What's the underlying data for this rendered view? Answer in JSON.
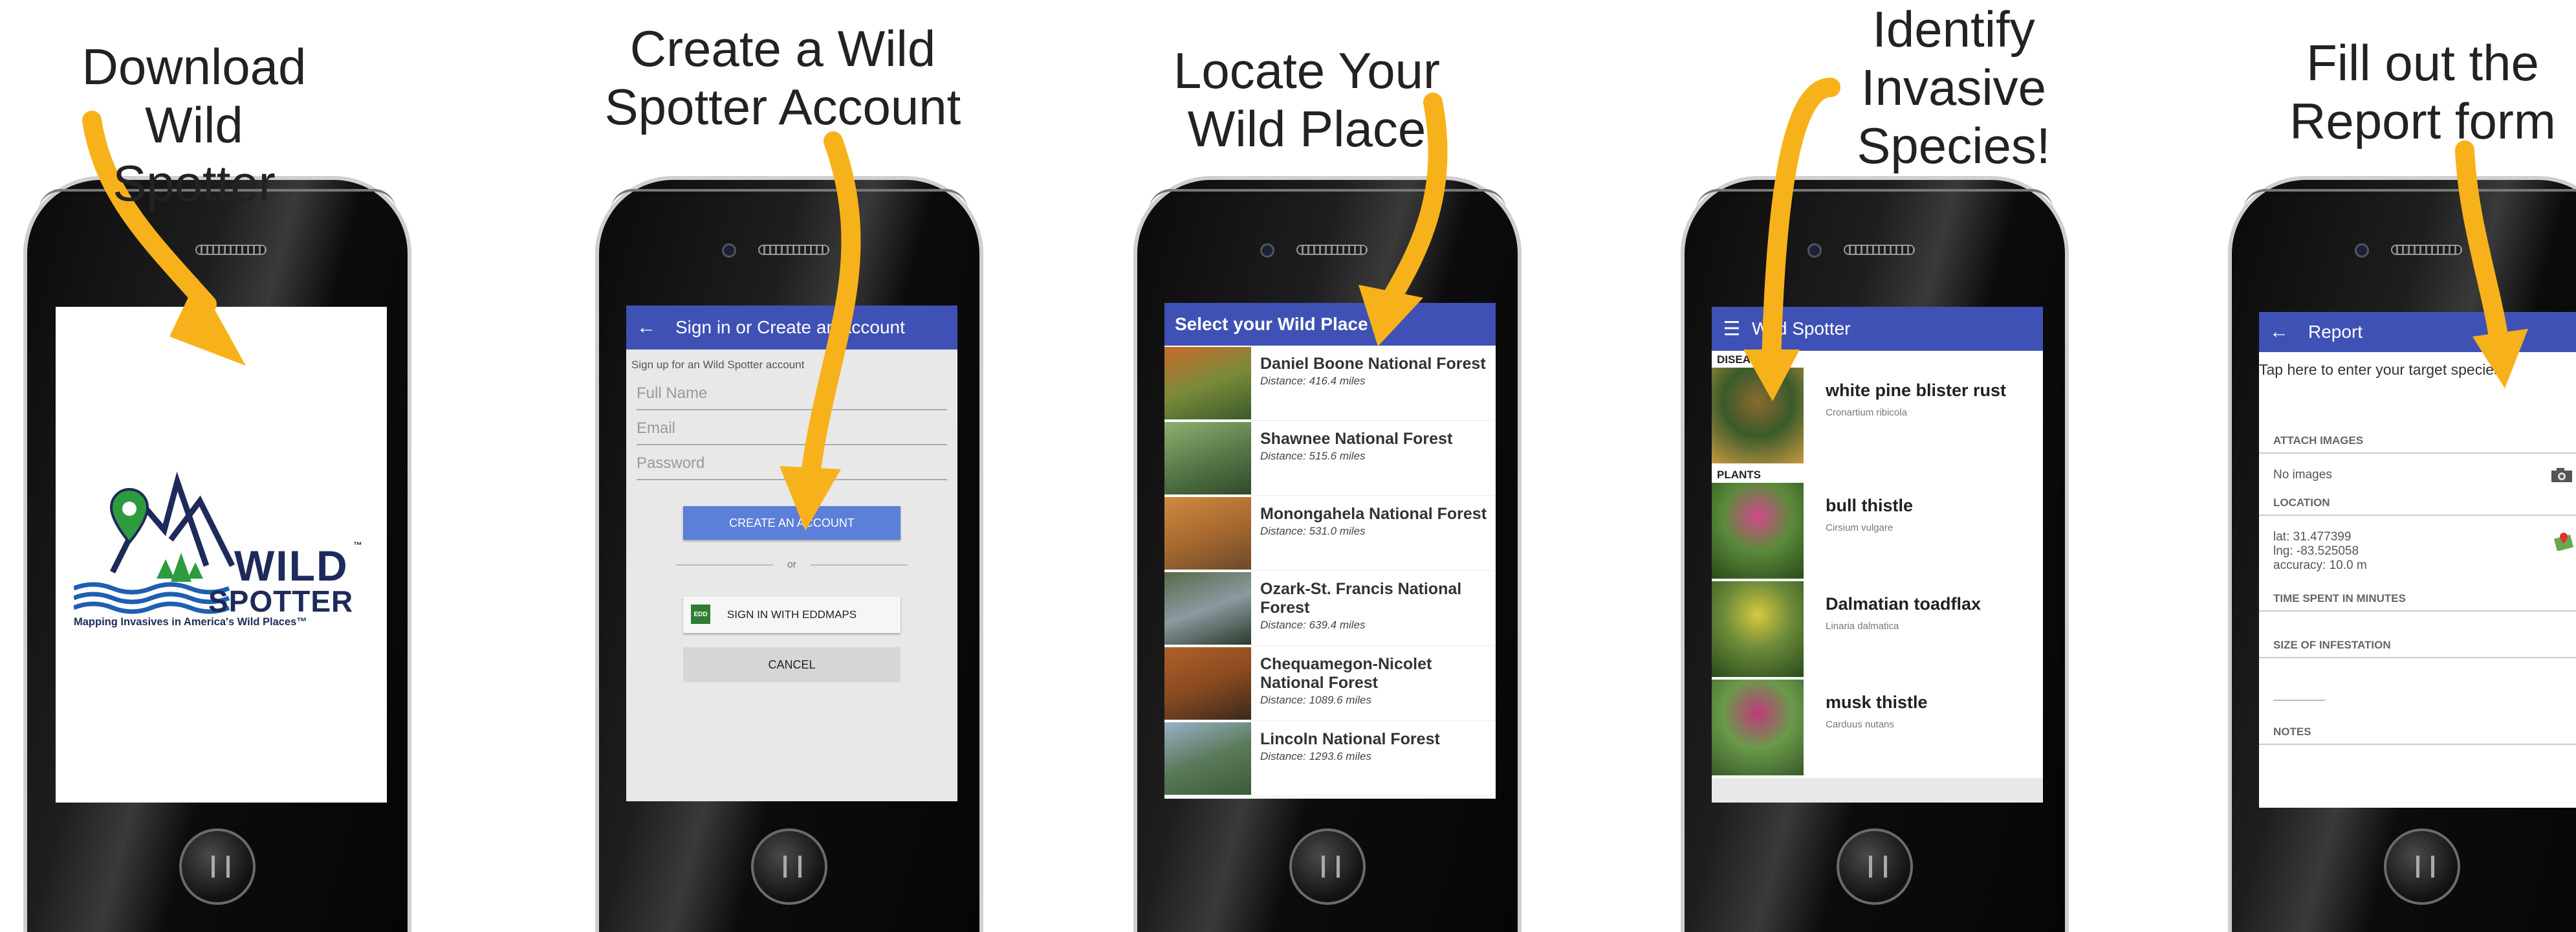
{
  "steps": [
    {
      "caption": "Download Wild\nSpotter"
    },
    {
      "caption": "Create a Wild\nSpotter Account"
    },
    {
      "caption": "Locate Your\nWild Place"
    },
    {
      "caption": "Identify\nInvasive\nSpecies!"
    },
    {
      "caption": "Fill out the\nReport form"
    }
  ],
  "logo": {
    "wild": "WILD",
    "spotter": "SPOTTER",
    "tm": "™",
    "tagline": "Mapping Invasives in America's Wild Places™"
  },
  "signin": {
    "title": "Sign in or Create an account",
    "signup_text": "Sign up for an Wild Spotter account",
    "full_name_placeholder": "Full Name",
    "email_placeholder": "Email",
    "password_placeholder": "Password",
    "create_button": "CREATE AN ACCOUNT",
    "or_text": "or",
    "eddmaps_button": "SIGN IN WITH EDDMAPS",
    "eddmaps_mark": "EDD",
    "cancel_button": "CANCEL"
  },
  "places": {
    "title": "Select your Wild Place",
    "items": [
      {
        "name": "Daniel Boone National Forest",
        "distance": "Distance: 416.4 miles",
        "colors": [
          "#c86a2a",
          "#7a8a3a",
          "#3b5a2a"
        ]
      },
      {
        "name": "Shawnee National Forest",
        "distance": "Distance: 515.6 miles",
        "colors": [
          "#8fb070",
          "#5a7a4a",
          "#2e4a2a"
        ]
      },
      {
        "name": "Monongahela National Forest",
        "distance": "Distance: 531.0 miles",
        "colors": [
          "#d08a40",
          "#a86a30",
          "#6b4a2a"
        ]
      },
      {
        "name": "Ozark-St. Francis National Forest",
        "distance": "Distance: 639.4 miles",
        "colors": [
          "#5a6a4a",
          "#8a9aa0",
          "#2a3a2a"
        ]
      },
      {
        "name": "Chequamegon-Nicolet National Forest",
        "distance": "Distance: 1089.6 miles",
        "colors": [
          "#b0602a",
          "#8a4a20",
          "#3a2a1a"
        ]
      },
      {
        "name": "Lincoln National Forest",
        "distance": "Distance: 1293.6 miles",
        "colors": [
          "#9ab0c8",
          "#5a7a5a",
          "#3a5a3a"
        ]
      }
    ]
  },
  "species": {
    "title": "Wild Spotter",
    "diseases_header": "DISEASES",
    "plants_header": "PLANTS",
    "items": [
      {
        "name": "white pine blister rust",
        "scientific": "Cronartium ribicola",
        "colors": [
          "#8a6a30",
          "#3a5a2a",
          "#c89a40"
        ]
      },
      {
        "name": "bull thistle",
        "scientific": "Cirsium vulgare",
        "colors": [
          "#d24a8a",
          "#5a8a3a",
          "#2a4a1a"
        ]
      },
      {
        "name": "Dalmatian toadflax",
        "scientific": "Linaria dalmatica",
        "colors": [
          "#d8c840",
          "#6a8a3a",
          "#2a4a1a"
        ]
      },
      {
        "name": "musk thistle",
        "scientific": "Carduus nutans",
        "colors": [
          "#c03a7a",
          "#6a9a4a",
          "#3a5a2a"
        ]
      }
    ]
  },
  "report": {
    "title": "Report",
    "target_prompt": "Tap here to enter your target species",
    "attach_images_label": "ATTACH IMAGES",
    "no_images": "No images",
    "location_label": "LOCATION",
    "lat": "lat:  31.477399",
    "lng": "lng: -83.525058",
    "accuracy": "accuracy:  10.0 m",
    "time_label": "TIME SPENT IN MINUTES",
    "size_label": "SIZE OF INFESTATION",
    "notes_label": "NOTES"
  },
  "icons": {
    "arrow": "down-arrow-icon",
    "back": "back-arrow-icon",
    "menu": "hamburger-menu-icon",
    "camera": "camera-icon",
    "map": "map-pin-icon"
  },
  "colors": {
    "arrow": "#f7b21b",
    "appbar": "#3f51b5",
    "create_button": "#5c7fd8",
    "logo_navy": "#1e2a5a",
    "logo_green": "#2e9b3e",
    "logo_blue": "#1e5fb0"
  }
}
